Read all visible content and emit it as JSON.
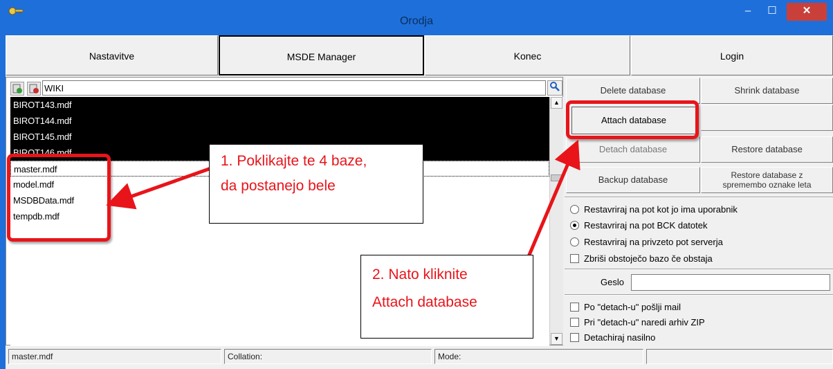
{
  "window": {
    "title": "Orodja",
    "min_label": "–",
    "max_label": "☐",
    "close_label": "✕"
  },
  "top_buttons": [
    "Nastavitve",
    "MSDE Manager",
    "Konec",
    "Login"
  ],
  "search": {
    "value": "WIKI",
    "search_icon": "magnifier-icon"
  },
  "list": {
    "items": [
      "BIROT143.mdf",
      "BIROT144.mdf",
      "BIROT145.mdf",
      "BIROT146.mdf",
      "master.mdf",
      "model.mdf",
      "MSDBData.mdf",
      "tempdb.mdf"
    ],
    "selected": [
      0,
      1,
      2,
      3
    ],
    "focused": 4
  },
  "buttons": {
    "delete": "Delete database",
    "shrink": "Shrink database",
    "attach": "Attach database",
    "detach": "Detach database",
    "restore": "Restore database",
    "backup": "Backup database",
    "restore_z_line1": "Restore database z",
    "restore_z_line2": "spremembo oznake leta"
  },
  "restore_options": [
    {
      "label": "Restavriraj na pot kot jo ima uporabnik",
      "checked": false
    },
    {
      "label": "Restavriraj na pot BCK datotek",
      "checked": true
    },
    {
      "label": "Restavriraj na privzeto pot serverja",
      "checked": false
    }
  ],
  "delete_existing": "Zbriši obstoječo bazo če obstaja",
  "password": {
    "label": "Geslo",
    "value": ""
  },
  "detach_options": [
    "Po \"detach-u\" pošlji mail",
    "Pri \"detach-u\" naredi arhiv ZIP",
    "Detachiraj nasilno"
  ],
  "status_bar": [
    "master.mdf",
    "Collation:",
    "Mode:",
    ""
  ],
  "annotations": {
    "note1_line1": "1. Poklikajte te 4 baze,",
    "note1_line2": "da postanejo bele",
    "note2_line1": "2. Nato kliknite",
    "note2_line2": "Attach database",
    "color": "#e8141a"
  }
}
